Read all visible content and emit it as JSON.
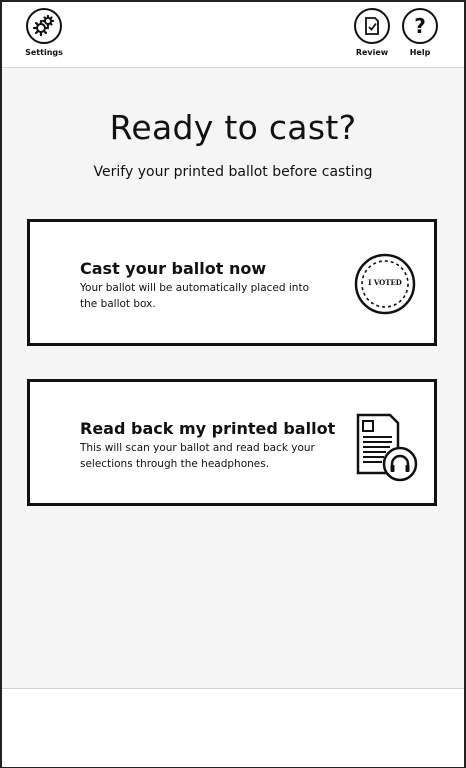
{
  "topbar": {
    "settings_label": "Settings",
    "review_label": "Review",
    "help_label": "Help",
    "help_glyph": "?",
    "icons": [
      "gears-icon",
      "review-icon",
      "help-icon"
    ]
  },
  "main": {
    "title": "Ready to cast?",
    "subtitle": "Verify your printed ballot before casting"
  },
  "options": [
    {
      "title": "Cast your ballot now",
      "description": "Your ballot will be automatically placed into the ballot box.",
      "icon": "i-voted-sticker-icon",
      "badge_text": "I VOTED"
    },
    {
      "title": "Read back my printed ballot",
      "description": "This will scan your ballot and read back your selections through the headphones.",
      "icon": "ballot-headphones-icon"
    }
  ],
  "colors": {
    "background": "#f5f5f5",
    "panel": "#ffffff",
    "stroke": "#111111"
  }
}
